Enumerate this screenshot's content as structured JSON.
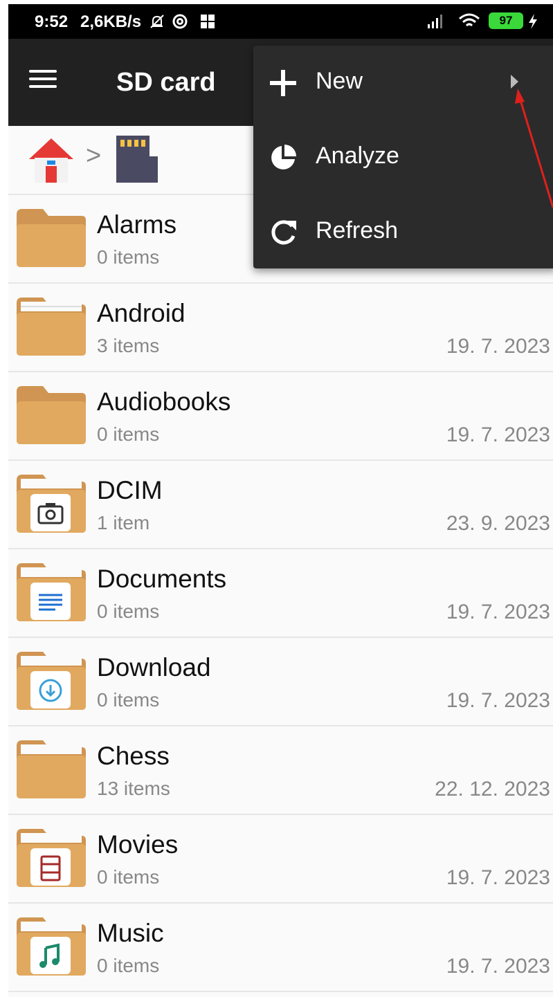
{
  "status_bar": {
    "time": "9:52",
    "net_speed": "2,6KB/s",
    "battery": "97",
    "icons": [
      "bell-off-icon",
      "at-icon",
      "windows-icon",
      "signal-icon",
      "wifi-icon",
      "battery-icon",
      "charging-icon"
    ]
  },
  "toolbar": {
    "title": "SD card",
    "menu_icon": "hamburger-icon"
  },
  "breadcrumb": {
    "separator": ">",
    "items": [
      "home-icon",
      "sd-card-icon"
    ]
  },
  "popup_menu": {
    "items": [
      {
        "label": "New",
        "icon": "plus-icon",
        "has_submenu": true
      },
      {
        "label": "Analyze",
        "icon": "pie-chart-icon"
      },
      {
        "label": "Refresh",
        "icon": "refresh-icon"
      }
    ]
  },
  "files": [
    {
      "name": "Alarms",
      "count": "0 items",
      "date": "",
      "badge": ""
    },
    {
      "name": "Android",
      "count": "3 items",
      "date": "19. 7. 2023",
      "badge": ""
    },
    {
      "name": "Audiobooks",
      "count": "0 items",
      "date": "19. 7. 2023",
      "badge": ""
    },
    {
      "name": "DCIM",
      "count": "1 item",
      "date": "23. 9. 2023",
      "badge": "camera-icon"
    },
    {
      "name": "Documents",
      "count": "0 items",
      "date": "19. 7. 2023",
      "badge": "document-icon"
    },
    {
      "name": "Download",
      "count": "0 items",
      "date": "19. 7. 2023",
      "badge": "download-icon"
    },
    {
      "name": "Chess",
      "count": "13 items",
      "date": "22. 12. 2023",
      "badge": ""
    },
    {
      "name": "Movies",
      "count": "0 items",
      "date": "19. 7. 2023",
      "badge": "film-icon"
    },
    {
      "name": "Music",
      "count": "0 items",
      "date": "19. 7. 2023",
      "badge": "music-icon"
    }
  ],
  "colors": {
    "toolbar": "#212121",
    "menu": "#2b2b2b",
    "folder": "#e1a95f",
    "folder_dark": "#d09552",
    "annotation": "#e0201c"
  }
}
